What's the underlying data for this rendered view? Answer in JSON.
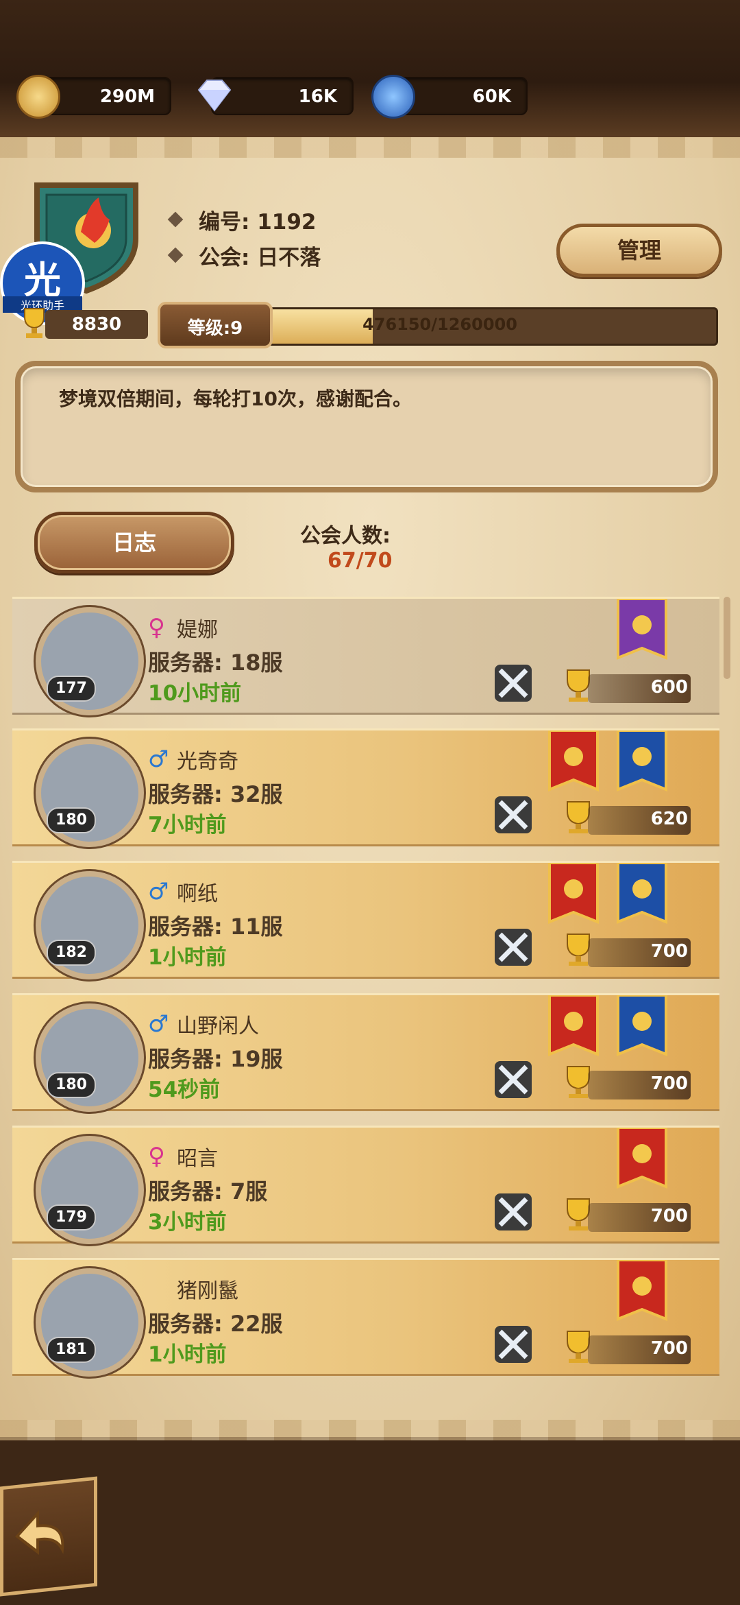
{
  "resources": [
    {
      "icon": "gold-coin-icon",
      "value": "290M"
    },
    {
      "icon": "diamond-icon",
      "value": "16K"
    },
    {
      "icon": "blue-gem-icon",
      "value": "60K"
    }
  ],
  "guild": {
    "id_label": "编号: 1192",
    "name_label": "公会: 日不落",
    "manage_label": "管理",
    "trophy_total": "8830",
    "level_label": "等级:9",
    "exp_text": "476150/1260000",
    "exp_fraction": 0.378,
    "notice": "梦境双倍期间，每轮打10次，感谢配合。",
    "log_label": "日志",
    "members_label": "公会人数:",
    "members_count": "67/70"
  },
  "watermark": {
    "line1": "光",
    "line2": "光环助手"
  },
  "members": [
    {
      "gender": "♀",
      "name": "媞娜",
      "server": "服务器: 18服",
      "last": "10小时前",
      "level": "177",
      "score": "600",
      "banners": [
        "purple-crown"
      ],
      "self": true
    },
    {
      "gender": "♂",
      "name": "光奇奇",
      "server": "服务器: 32服",
      "last": "7小时前",
      "level": "180",
      "score": "620",
      "banners": [
        "red",
        "blue"
      ]
    },
    {
      "gender": "♂",
      "name": "啊纸",
      "server": "服务器: 11服",
      "last": "1小时前",
      "level": "182",
      "score": "700",
      "banners": [
        "red",
        "blue"
      ]
    },
    {
      "gender": "♂",
      "name": "山野闲人",
      "server": "服务器: 19服",
      "last": "54秒前",
      "level": "180",
      "score": "700",
      "banners": [
        "red",
        "blue"
      ]
    },
    {
      "gender": "♀",
      "name": "昭言",
      "server": "服务器: 7服",
      "last": "3小时前",
      "level": "179",
      "score": "700",
      "banners": [
        "red"
      ]
    },
    {
      "gender": "",
      "name": "猪刚鬣",
      "server": "服务器: 22服",
      "last": "1小时前",
      "level": "181",
      "score": "700",
      "banners": [
        "red"
      ]
    }
  ],
  "colors": {
    "male": "#2a78d1",
    "female": "#d8338f",
    "online": "#4f9a1d",
    "accent": "#c14a1c"
  }
}
